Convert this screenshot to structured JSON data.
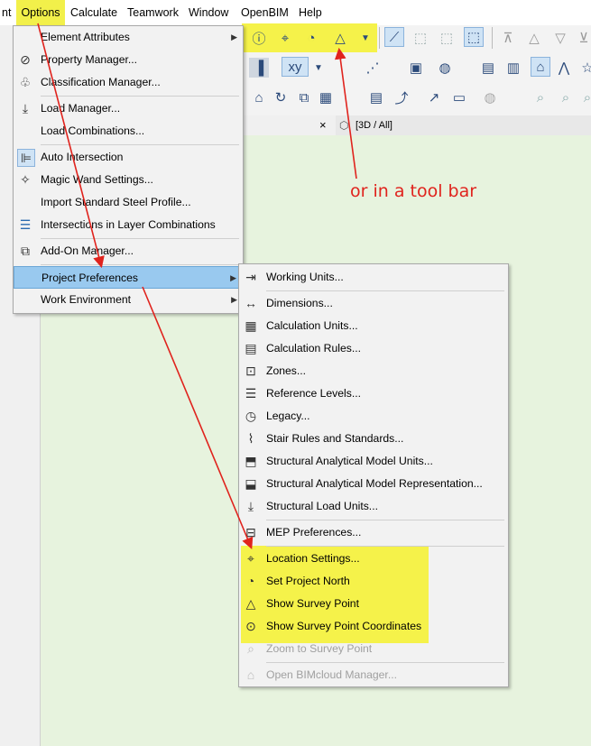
{
  "menubar": {
    "items": [
      {
        "label": "nt"
      },
      {
        "label": "Options"
      },
      {
        "label": "Calculate"
      },
      {
        "label": "Teamwork"
      },
      {
        "label": "Window"
      },
      {
        "label": "OpenBIM"
      },
      {
        "label": "Help"
      }
    ]
  },
  "tab_3d": {
    "label": "[3D / All]",
    "close": "×"
  },
  "options_menu": {
    "items": [
      {
        "label": "Element Attributes",
        "icon": "blank",
        "submenu": true
      },
      {
        "label": "Property Manager...",
        "icon": "tag-icon"
      },
      {
        "label": "Classification Manager...",
        "icon": "tree-icon"
      },
      {
        "label": "Load Manager...",
        "icon": "load-icon"
      },
      {
        "label": "Load Combinations...",
        "icon": "blank"
      },
      {
        "label": "Auto Intersection",
        "icon": "intersection-icon"
      },
      {
        "label": "Magic Wand Settings...",
        "icon": "wand-icon"
      },
      {
        "label": "Import Standard Steel Profile...",
        "icon": "blank"
      },
      {
        "label": "Intersections in Layer Combinations",
        "icon": "layers-icon"
      },
      {
        "label": "Add-On Manager...",
        "icon": "addon-icon"
      },
      {
        "label": "Project Preferences",
        "icon": "blank",
        "submenu": true
      },
      {
        "label": "Work Environment",
        "icon": "blank",
        "submenu": true
      }
    ]
  },
  "preferences_submenu": {
    "items": [
      {
        "label": "Working Units...",
        "icon": "units-icon"
      },
      {
        "label": "Dimensions...",
        "icon": "dimension-icon"
      },
      {
        "label": "Calculation Units...",
        "icon": "calc-units-icon"
      },
      {
        "label": "Calculation Rules...",
        "icon": "calc-rules-icon"
      },
      {
        "label": "Zones...",
        "icon": "zones-icon"
      },
      {
        "label": "Reference Levels...",
        "icon": "levels-icon"
      },
      {
        "label": "Legacy...",
        "icon": "legacy-icon"
      },
      {
        "label": "Stair Rules and Standards...",
        "icon": "stair-icon"
      },
      {
        "label": "Structural Analytical Model Units...",
        "icon": "struct-units-icon"
      },
      {
        "label": "Structural Analytical Model Representation...",
        "icon": "struct-repr-icon"
      },
      {
        "label": "Structural Load Units...",
        "icon": "struct-load-icon"
      },
      {
        "label": "MEP Preferences...",
        "icon": "mep-icon"
      },
      {
        "label": "Location Settings...",
        "icon": "location-icon"
      },
      {
        "label": "Set Project North",
        "icon": "compass-icon"
      },
      {
        "label": "Show Survey Point",
        "icon": "survey-point-icon"
      },
      {
        "label": "Show Survey Point Coordinates",
        "icon": "coordinates-icon"
      },
      {
        "label": "Zoom to Survey Point",
        "icon": "zoom-icon",
        "disabled": true
      },
      {
        "label": "Open BIMcloud Manager...",
        "icon": "bimcloud-icon",
        "disabled": true
      }
    ]
  },
  "annotation": {
    "text": "or in a tool bar"
  },
  "colors": {
    "highlight_yellow": "#f5f24a",
    "arrow_red": "#e0231d",
    "menu_highlight": "#99c9ef",
    "canvas_green": "#e7f3de"
  }
}
